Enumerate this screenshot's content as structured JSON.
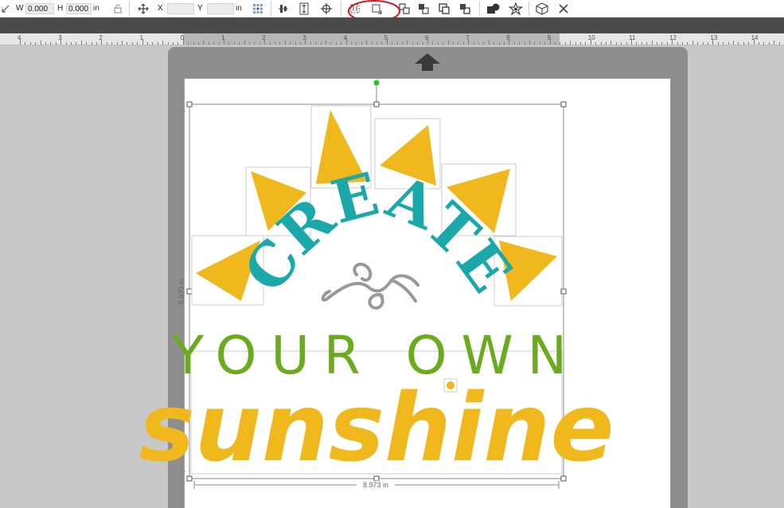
{
  "toolbar": {
    "w_label": "W",
    "w_value": "0.000",
    "h_label": "H",
    "h_value": "0.000",
    "size_unit": "in",
    "x_label": "X",
    "x_value": "",
    "y_label": "Y",
    "y_value": "",
    "pos_unit": "in",
    "icons": [
      "resize-corner-icon",
      "lock-ratio-icon",
      "move-icon",
      "position-grid-icon",
      "align-icon",
      "center-vertical-icon",
      "center-target-icon",
      "send-backward-icon",
      "bring-forward-icon",
      "group-icon",
      "ungroup-icon",
      "weld-icon",
      "subtract-icon",
      "fill-shape-icon",
      "star-icon",
      "box-3d-icon",
      "close-icon"
    ],
    "highlight_color": "#d9121a"
  },
  "ruler": {
    "labels": [
      "4",
      "3",
      "2",
      "1",
      "0",
      "1",
      "2",
      "3",
      "4",
      "5",
      "6",
      "7",
      "8",
      "9",
      "10",
      "11",
      "12",
      "13",
      "14"
    ]
  },
  "design": {
    "line1": "CREATE",
    "line2": "YOUR OWN",
    "line3": "sunshine",
    "width_label": "8.973 in",
    "height_label": "8.973 in"
  },
  "colors": {
    "teal": "#1aa8a8",
    "gray_flourish": "#999999",
    "green": "#6aab1f",
    "yellow": "#f0b81c",
    "rotate_handle": "#2ec12e"
  }
}
